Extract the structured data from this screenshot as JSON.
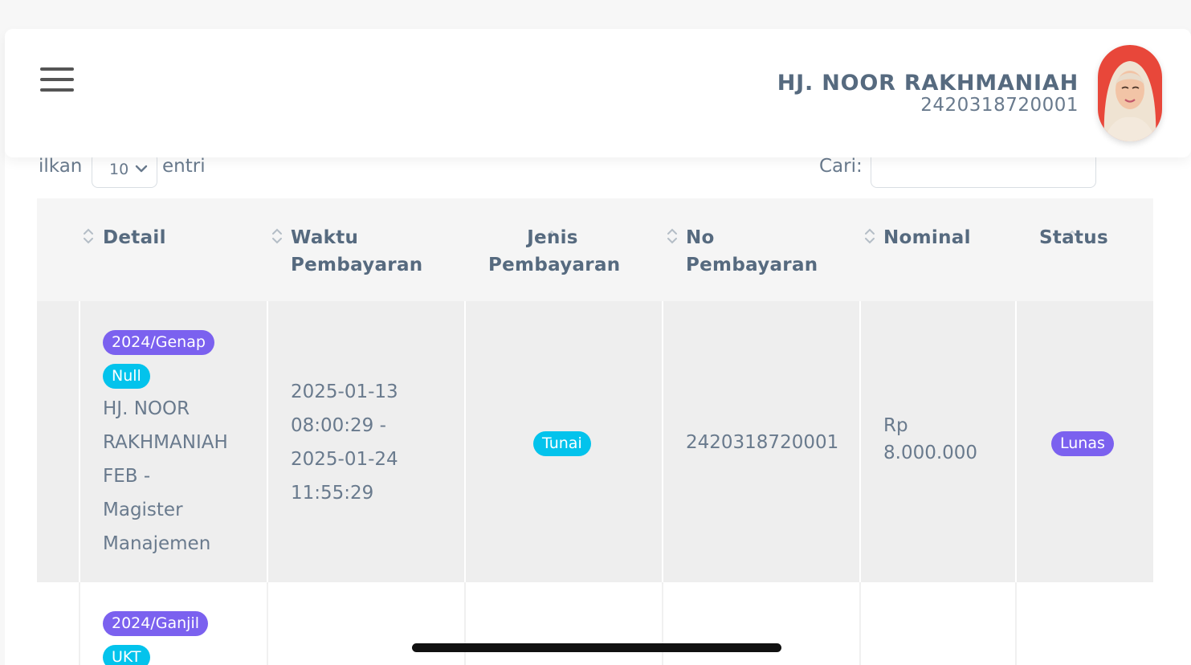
{
  "header": {
    "user_name": "HJ. NOOR RAKHMANIAH",
    "user_id": "2420318720001"
  },
  "controls": {
    "show_label": "ilkan",
    "page_length": "10",
    "entries_label": "entri",
    "search_label": "Cari:",
    "search_value": ""
  },
  "table": {
    "headers": [
      "Detail",
      "Waktu Pembayaran",
      "Jenis Pembayaran",
      "No Pembayaran",
      "Nominal",
      "Status"
    ],
    "header_lines": {
      "detail": "Detail",
      "waktu_1": "Waktu",
      "waktu_2": "Pembayaran",
      "jenis_1": "Jenis",
      "jenis_2": "Pembayaran",
      "no_1": "No",
      "no_2": "Pembayaran",
      "nominal": "Nominal",
      "status": "Status"
    },
    "rows": [
      {
        "semester_badge": "2024/Genap",
        "type_badge": "Null",
        "detail_lines": [
          "HJ. NOOR",
          "RAKHMANIAH",
          "FEB -",
          "Magister",
          "Manajemen"
        ],
        "waktu_lines": [
          "2025-01-13",
          "08:00:29 -",
          "2025-01-24",
          "11:55:29"
        ],
        "jenis": "Tunai",
        "no_pembayaran": "2420318720001",
        "nominal_lines": [
          "Rp",
          "8.000.000"
        ],
        "status": "Lunas"
      },
      {
        "semester_badge": "2024/Ganjil",
        "type_badge": "UKT"
      }
    ]
  },
  "colors": {
    "badge_purple": "#7b61ef",
    "badge_cyan": "#03c3ec",
    "text": "#566a7f"
  }
}
